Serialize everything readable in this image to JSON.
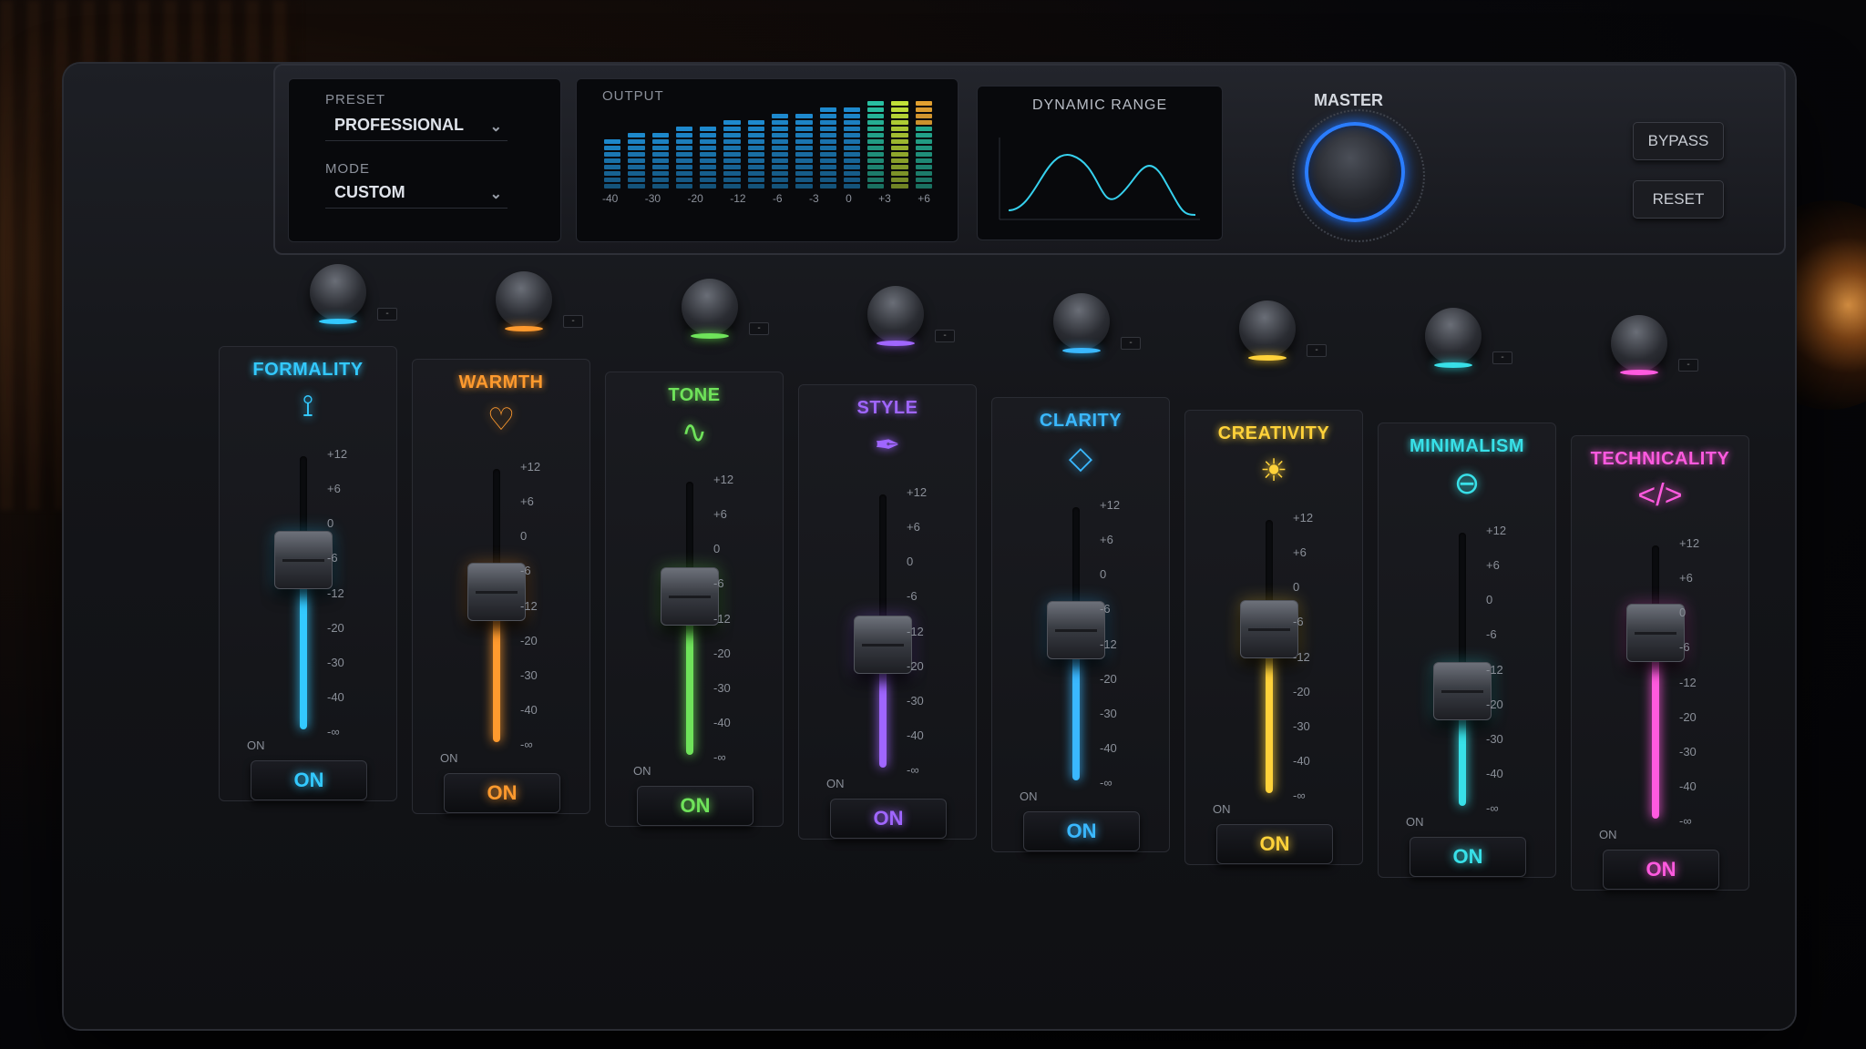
{
  "top": {
    "preset_label": "PRESET",
    "preset_value": "PROFESSIONAL",
    "mode_label": "MODE",
    "mode_value": "CUSTOM",
    "output_label": "OUTPUT",
    "output_scale": [
      "-40",
      "-30",
      "-20",
      "-12",
      "-6",
      "-3",
      "0",
      "+3",
      "+6"
    ],
    "dynamic_range_label": "DYNAMIC RANGE",
    "master_label": "MASTER",
    "bypass_label": "BYPASS",
    "reset_label": "RESET"
  },
  "scale_labels": [
    "+12",
    "+6",
    "0",
    "-6",
    "-12",
    "-20",
    "-30",
    "-40",
    "-∞"
  ],
  "on_caption": "ON",
  "on_label": "ON",
  "channels": [
    {
      "label": "FORMALITY",
      "icon": "tie-icon",
      "glyph": "⟟",
      "color": "#33c9ff",
      "level": 0.62
    },
    {
      "label": "WARMTH",
      "icon": "heart-icon",
      "glyph": "♡",
      "color": "#ff9a2e",
      "level": 0.55
    },
    {
      "label": "TONE",
      "icon": "waveform-icon",
      "glyph": "∿",
      "color": "#6fe35a",
      "level": 0.58
    },
    {
      "label": "STYLE",
      "icon": "pen-icon",
      "glyph": "✒",
      "color": "#a066ff",
      "level": 0.45
    },
    {
      "label": "CLARITY",
      "icon": "diamond-icon",
      "glyph": "◇",
      "color": "#3ab8ff",
      "level": 0.55
    },
    {
      "label": "CREATIVITY",
      "icon": "lightbulb-icon",
      "glyph": "☀",
      "color": "#ffd23a",
      "level": 0.6
    },
    {
      "label": "MINIMALISM",
      "icon": "minus-circle-icon",
      "glyph": "⊖",
      "color": "#38e0e8",
      "level": 0.42
    },
    {
      "label": "TECHNICALITY",
      "icon": "code-icon",
      "glyph": "</>",
      "color": "#ff5adf",
      "level": 0.68
    }
  ]
}
